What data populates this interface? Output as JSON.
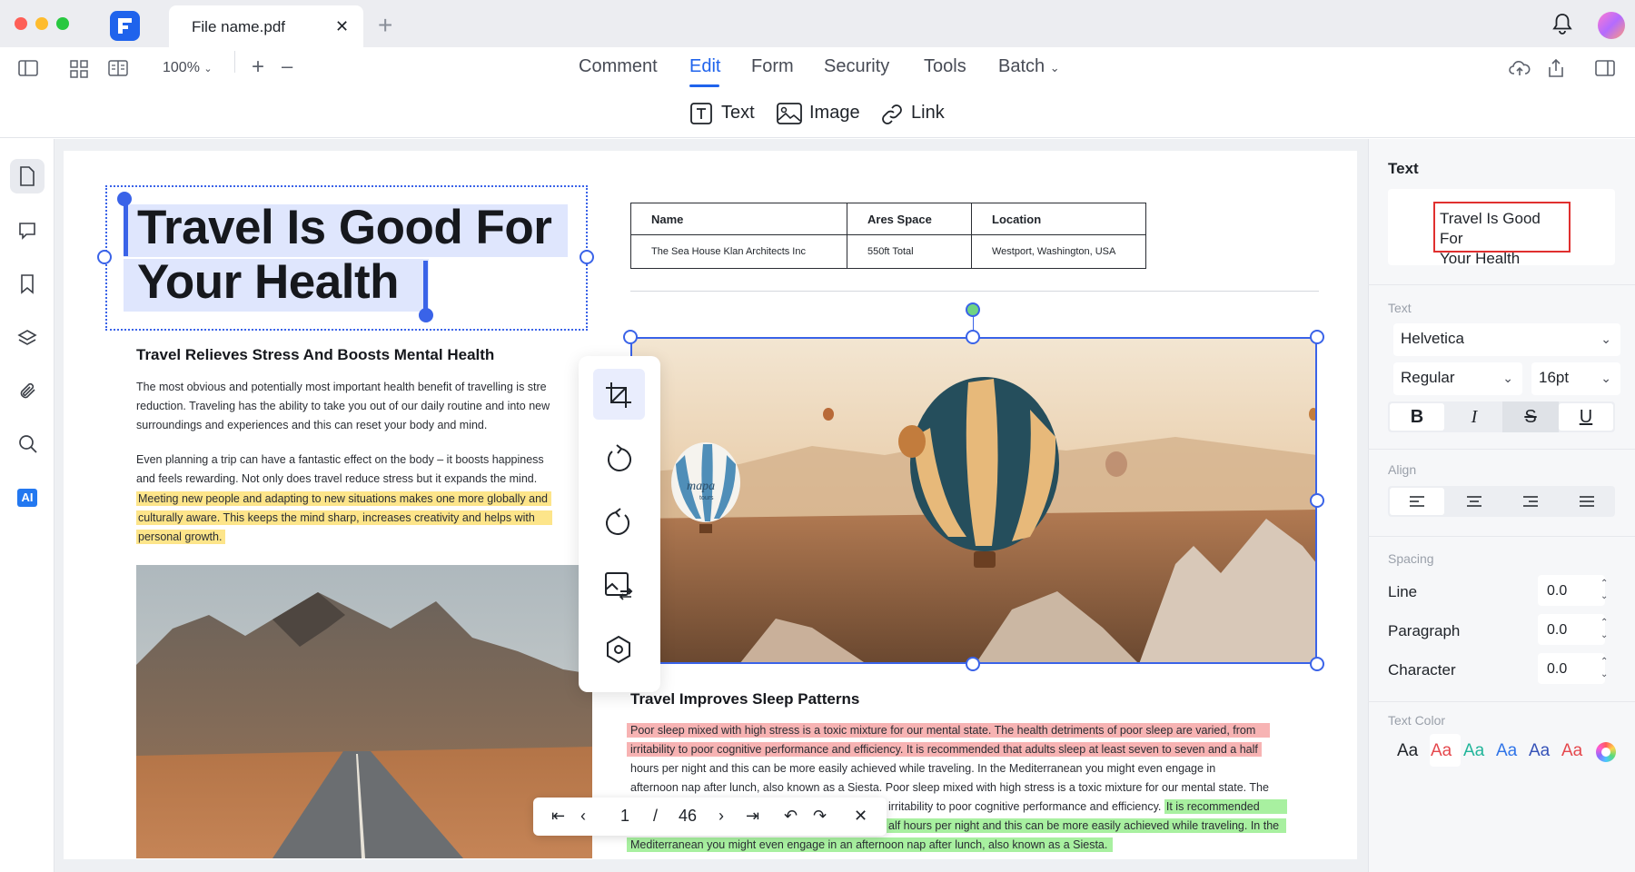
{
  "window": {
    "tab_title": "File name.pdf",
    "tab_close": "✕",
    "new_tab": "+"
  },
  "toolbar": {
    "zoom": "100%",
    "zoom_in": "+",
    "zoom_out": "–",
    "menus": [
      "Comment",
      "Edit",
      "Form",
      "Security",
      "Tools",
      "Batch"
    ],
    "active_menu": "Edit",
    "edit_tools": [
      "Text",
      "Image",
      "Link"
    ]
  },
  "sidebar": {
    "items": [
      "page-icon",
      "comment-icon",
      "bookmark-icon",
      "layers-icon",
      "attachment-icon",
      "search-icon",
      "ai-icon"
    ],
    "ai_label": "AI"
  },
  "document": {
    "title_line1": "Travel Is Good For",
    "title_line2": "Your Health",
    "heading1": "Travel Relieves Stress And Boosts Mental Health",
    "para1_l1": "The most obvious and potentially most important health benefit of travelling is stre",
    "para1_l2": "reduction. Traveling has the ability to take you out of our daily routine and into new",
    "para1_l3": "surroundings and experiences and this can reset your body and mind.",
    "para2_l1": "Even planning a trip can have a fantastic effect on the body – it boosts happiness",
    "para2_l2": "and feels rewarding. Not only does travel reduce stress but it expands the mind.",
    "para2_l3": "Meeting new people and adapting to new situations makes one more globally and",
    "para2_l4": "culturally aware. This keeps the mind sharp, increases creativity and helps with",
    "para2_l5": "personal growth.",
    "table": {
      "headers": [
        "Name",
        "Ares Space",
        "Location"
      ],
      "row": [
        "The Sea House Klan Architects Inc",
        "550ft Total",
        "Westport, Washington, USA"
      ]
    },
    "balloon_text": "mapa",
    "balloon_sub": "tours",
    "heading2": "Travel Improves Sleep Patterns",
    "para3_l1": "Poor sleep mixed with high stress is a toxic mixture for our mental state. The health detriments of poor sleep are varied, from",
    "para3_l2": "irritability to poor cognitive performance and efficiency. It is recommended that adults sleep at least seven to seven and a half",
    "para3_l3": "hours per night and this can be more easily achieved while traveling. In the Mediterranean you might even engage in",
    "para3_l4": "afternoon nap after lunch, also known as a Siesta. Poor sleep mixed with high stress is a toxic mixture for our mental state. The",
    "para3_l5a": "irritability to poor cognitive performance and efficiency.",
    "para3_l5b": "It is recommended",
    "para3_l6a": "alf hours per night and this can be more easily achieved while traveling. In the",
    "para3_l7": "Mediterranean you might even engage in an afternoon nap after lunch, also known as a Siesta."
  },
  "pager": {
    "current": "1",
    "separator": "/",
    "total": "46"
  },
  "panel": {
    "section_title": "Text",
    "preview_text_l1": "Travel Is Good For",
    "preview_text_l2": "Your Health",
    "font_label": "Text",
    "font_family": "Helvetica",
    "font_weight": "Regular",
    "font_size": "16pt",
    "style_buttons": [
      "B",
      "I",
      "S",
      "U"
    ],
    "align_label": "Align",
    "spacing_label": "Spacing",
    "line_label": "Line",
    "line_value": "0.0",
    "paragraph_label": "Paragraph",
    "paragraph_value": "0.0",
    "character_label": "Character",
    "character_value": "0.0",
    "text_color_label": "Text Color",
    "swatch_text": "Aa",
    "swatch_colors": [
      "#1f2329",
      "#e5484d",
      "#22b59a",
      "#2f74e8",
      "#3552b8",
      "#e5484d"
    ]
  }
}
